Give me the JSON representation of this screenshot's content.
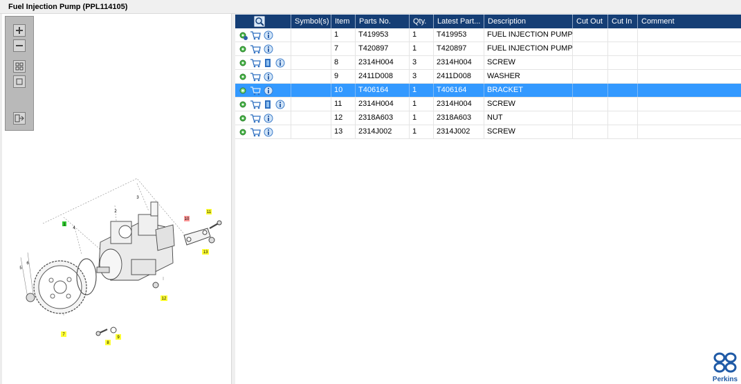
{
  "window": {
    "title": "Fuel Injection Pump (PPL114105)"
  },
  "toolbar": {
    "zoom_in": "zoom-in-icon",
    "zoom_out": "zoom-out-icon",
    "fit": "fit-icon",
    "actual": "actual-size-icon",
    "export": "export-icon"
  },
  "table": {
    "columns": [
      "",
      "Symbol(s)",
      "Item",
      "Parts No.",
      "Qty.",
      "Latest Part...",
      "Description",
      "Cut Out",
      "Cut In",
      "Comment"
    ],
    "rows": [
      {
        "item": "1",
        "part": "T419953",
        "qty": "1",
        "latest": "T419953",
        "desc": "FUEL INJECTION PUMP",
        "doc": false,
        "first": true
      },
      {
        "item": "7",
        "part": "T420897",
        "qty": "1",
        "latest": "T420897",
        "desc": "FUEL INJECTION PUMP G",
        "doc": false
      },
      {
        "item": "8",
        "part": "2314H004",
        "qty": "3",
        "latest": "2314H004",
        "desc": "SCREW",
        "doc": true
      },
      {
        "item": "9",
        "part": "2411D008",
        "qty": "3",
        "latest": "2411D008",
        "desc": "WASHER",
        "doc": false
      },
      {
        "item": "10",
        "part": "T406164",
        "qty": "1",
        "latest": "T406164",
        "desc": "BRACKET",
        "doc": false,
        "selected": true
      },
      {
        "item": "11",
        "part": "2314H004",
        "qty": "1",
        "latest": "2314H004",
        "desc": "SCREW",
        "doc": true
      },
      {
        "item": "12",
        "part": "2318A603",
        "qty": "1",
        "latest": "2318A603",
        "desc": "NUT",
        "doc": false
      },
      {
        "item": "13",
        "part": "2314J002",
        "qty": "1",
        "latest": "2314J002",
        "desc": "SCREW",
        "doc": false
      }
    ]
  },
  "diagram": {
    "labels": [
      "1",
      "2",
      "3",
      "4",
      "5",
      "6",
      "7",
      "8",
      "9",
      "10",
      "11",
      "12",
      "13"
    ],
    "highlight": {
      "green": "1",
      "red": "10",
      "yellow": [
        "7",
        "8",
        "9",
        "11",
        "12",
        "13"
      ]
    }
  },
  "logo": {
    "text": "Perkins",
    "color": "#1f5aa6"
  },
  "colors": {
    "header": "#153e75",
    "selected": "#3399ff"
  }
}
